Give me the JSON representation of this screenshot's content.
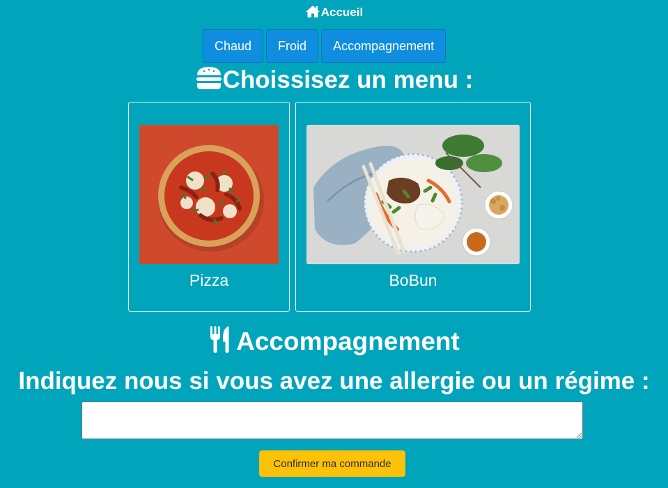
{
  "nav": {
    "home_label": "Accueil",
    "home_icon": "home-icon"
  },
  "tabs": [
    {
      "label": "Chaud"
    },
    {
      "label": "Froid"
    },
    {
      "label": "Accompagnement"
    }
  ],
  "menu_section": {
    "title": "Choissisez un menu :",
    "icon": "burger-icon"
  },
  "menu_items": [
    {
      "label": "Pizza",
      "image": "pizza-image"
    },
    {
      "label": "BoBun",
      "image": "bobun-image"
    }
  ],
  "side_section": {
    "title": "Accompagnement",
    "icon": "utensils-icon"
  },
  "allergy": {
    "prompt": "Indiquez nous si vous avez une allergie ou un régime :",
    "value": "",
    "placeholder": ""
  },
  "confirm_label": "Confirmer ma commande",
  "colors": {
    "background": "#00a5bc",
    "tab_button": "#0f8ee0",
    "confirm_button": "#fbc208",
    "text": "#ffffff"
  }
}
